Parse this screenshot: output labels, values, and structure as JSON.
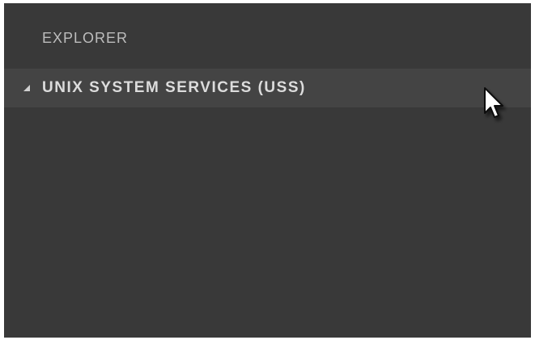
{
  "explorer": {
    "title": "EXPLORER",
    "sections": [
      {
        "label": "UNIX SYSTEM SERVICES (USS)",
        "expanded": true,
        "icon": "triangle-down-icon"
      }
    ]
  },
  "cursor": {
    "icon": "arrow-pointer-icon"
  },
  "colors": {
    "panel_background": "#393939",
    "section_header_background": "#444444",
    "title_text": "#bdbdbd",
    "section_text": "#dcdcdc"
  }
}
